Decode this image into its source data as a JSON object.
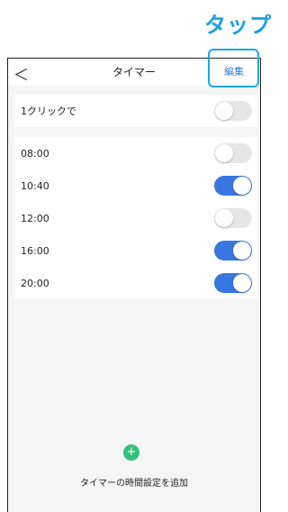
{
  "callout": "タップ",
  "topbar": {
    "back_symbol": "＜",
    "title": "タイマー",
    "edit_label": "編集"
  },
  "one_click": {
    "label": "1クリックで",
    "enabled": false
  },
  "timers": [
    {
      "time": "08:00",
      "enabled": false
    },
    {
      "time": "10:40",
      "enabled": true
    },
    {
      "time": "12:00",
      "enabled": false
    },
    {
      "time": "16:00",
      "enabled": true
    },
    {
      "time": "20:00",
      "enabled": true
    }
  ],
  "add": {
    "icon": "plus-icon",
    "symbol": "+",
    "label": "タイマーの時間設定を追加"
  },
  "colors": {
    "accent": "#3876e0",
    "add_green": "#33c27d",
    "callout": "#1a9fe3"
  }
}
